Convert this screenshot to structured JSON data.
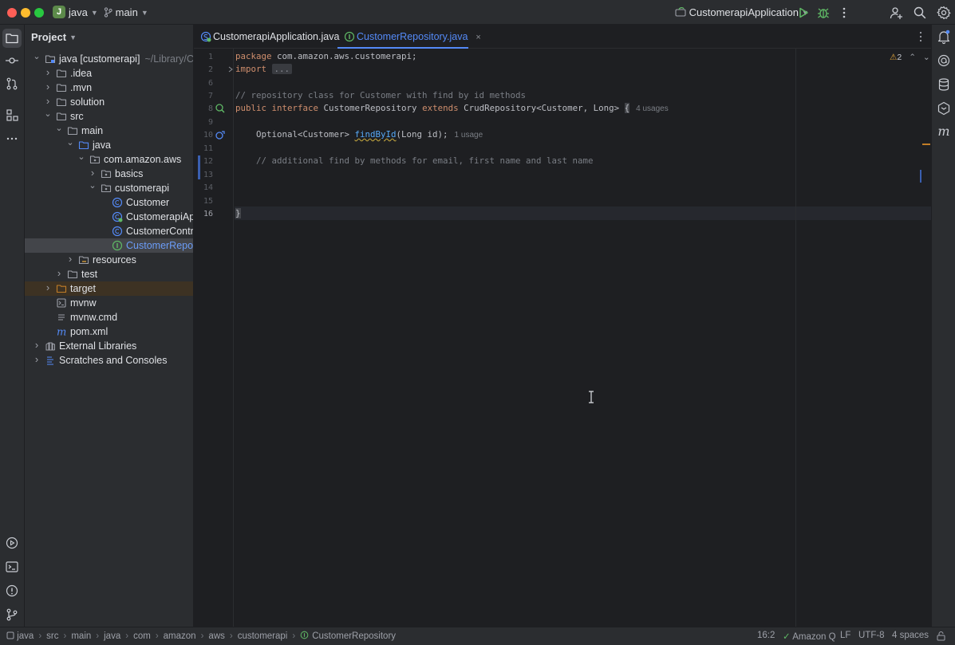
{
  "window": {
    "project_badge": "J",
    "project_name": "java",
    "branch": "main",
    "run_config": "CustomerapiApplication"
  },
  "project_panel": {
    "title": "Project",
    "tree": [
      {
        "label": "java [customerapi]",
        "hint": "~/Library/CloudSt",
        "indent": 0,
        "expanded": true,
        "icon": "folder-module-icon"
      },
      {
        "label": ".idea",
        "indent": 1,
        "expanded": false,
        "icon": "folder-icon"
      },
      {
        "label": ".mvn",
        "indent": 1,
        "expanded": false,
        "icon": "folder-icon"
      },
      {
        "label": "solution",
        "indent": 1,
        "expanded": false,
        "icon": "folder-icon"
      },
      {
        "label": "src",
        "indent": 1,
        "expanded": true,
        "icon": "folder-icon"
      },
      {
        "label": "main",
        "indent": 2,
        "expanded": true,
        "icon": "folder-icon"
      },
      {
        "label": "java",
        "indent": 3,
        "expanded": true,
        "icon": "source-folder-icon"
      },
      {
        "label": "com.amazon.aws",
        "indent": 4,
        "expanded": true,
        "icon": "package-icon"
      },
      {
        "label": "basics",
        "indent": 5,
        "expanded": false,
        "icon": "package-icon"
      },
      {
        "label": "customerapi",
        "indent": 5,
        "expanded": true,
        "icon": "package-icon"
      },
      {
        "label": "Customer",
        "indent": 6,
        "icon": "class-icon"
      },
      {
        "label": "CustomerapiApplic",
        "indent": 6,
        "icon": "spring-class-icon"
      },
      {
        "label": "CustomerControlle",
        "indent": 6,
        "icon": "class-icon"
      },
      {
        "label": "CustomerReposito",
        "indent": 6,
        "icon": "interface-icon",
        "selected": true
      },
      {
        "label": "resources",
        "indent": 3,
        "expanded": false,
        "icon": "resources-folder-icon"
      },
      {
        "label": "test",
        "indent": 2,
        "expanded": false,
        "icon": "folder-icon"
      },
      {
        "label": "target",
        "indent": 1,
        "expanded": false,
        "icon": "excluded-folder-icon",
        "highlight": true
      },
      {
        "label": "mvnw",
        "indent": 1,
        "icon": "script-file-icon"
      },
      {
        "label": "mvnw.cmd",
        "indent": 1,
        "icon": "text-file-icon"
      },
      {
        "label": "pom.xml",
        "indent": 1,
        "icon": "maven-icon"
      },
      {
        "label": "External Libraries",
        "indent": 0,
        "expanded": false,
        "icon": "library-icon"
      },
      {
        "label": "Scratches and Consoles",
        "indent": 0,
        "expanded": false,
        "icon": "scratches-icon"
      }
    ]
  },
  "tabs": [
    {
      "label": "CustomerapiApplication.java",
      "active": false
    },
    {
      "label": "CustomerRepository.java",
      "active": true,
      "close": "×"
    }
  ],
  "editor": {
    "warnings": "2",
    "line_numbers": [
      "1",
      "2",
      "6",
      "7",
      "8",
      "9",
      "10",
      "11",
      "12",
      "13",
      "14",
      "15",
      "16"
    ],
    "lines": {
      "l1_kw": "package",
      "l1_rest": " com.amazon.aws.customerapi;",
      "l2_kw": "import",
      "l2_fold": "...",
      "l7": "// repository class for Customer with find by id methods",
      "l8_kw1": "public",
      "l8_kw2": "interface",
      "l8_a": " CustomerRepository ",
      "l8_kw3": "extends",
      "l8_b": " CrudRepository<Customer, Long> ",
      "l8_brace": "{",
      "l8_usages": "4 usages",
      "l10_a": "    Optional<Customer> ",
      "l10_fn": "findById",
      "l10_b": "(Long id);",
      "l10_usages": "1 usage",
      "l12": "    // additional find by methods for email, first name and last name",
      "l16": "}"
    }
  },
  "status_bar": {
    "breadcrumbs": [
      "java",
      "src",
      "main",
      "java",
      "com",
      "amazon",
      "aws",
      "customerapi",
      "CustomerRepository"
    ],
    "position": "16:2",
    "amazon_q": "Amazon Q",
    "line_ending": "LF",
    "encoding": "UTF-8",
    "indent": "4 spaces"
  }
}
